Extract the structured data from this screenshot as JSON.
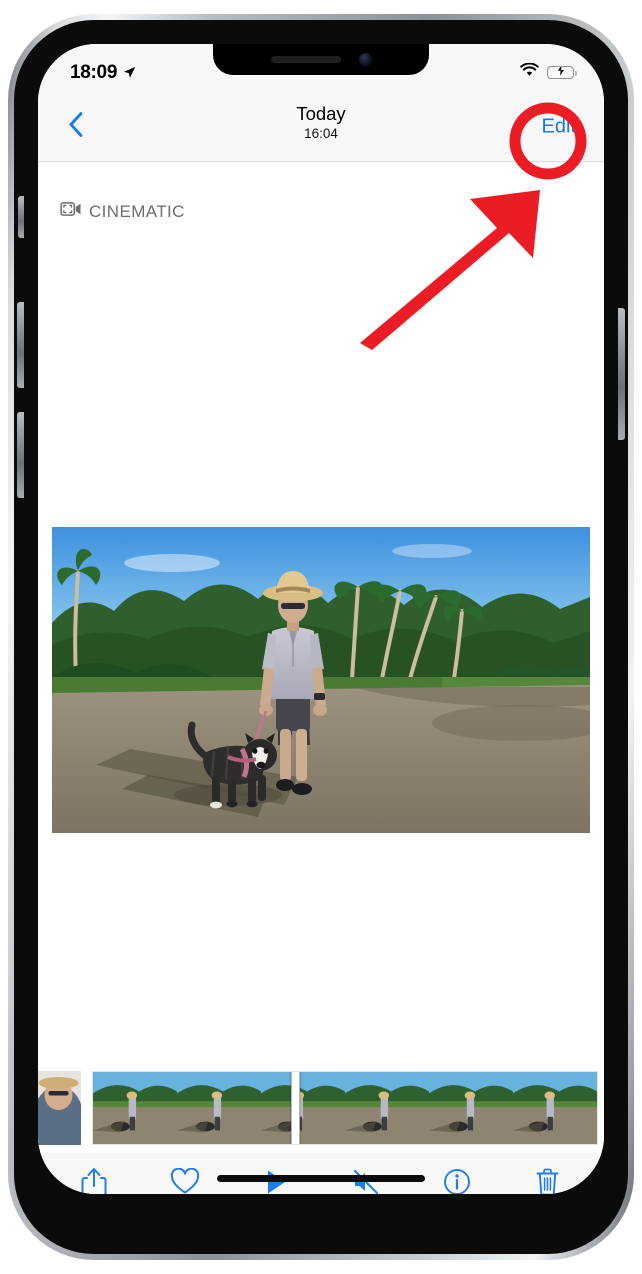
{
  "device": {
    "frame": "iphone",
    "notch_elements": [
      "earpiece-speaker",
      "front-camera"
    ],
    "hardware_buttons": [
      "ring-silent-switch",
      "volume-up-button",
      "volume-down-button",
      "side-power-button"
    ]
  },
  "status_bar": {
    "time": "18:09",
    "location_icon": "location-arrow-icon",
    "wifi_icon": "wifi-icon",
    "battery_icon": "battery-charging-icon",
    "battery_color": "#3ad14f",
    "battery_level_pct": 84
  },
  "nav_bar": {
    "back_icon": "chevron-left-icon",
    "title": "Today",
    "subtitle": "16:04",
    "edit_label": "Edit",
    "accent_color": "#1877f2"
  },
  "content": {
    "badge": {
      "icon": "cinematic-video-icon",
      "label": "CINEMATIC",
      "color": "#6e6e73"
    },
    "media": {
      "type": "video",
      "alt": "Man in straw sun hat holding a leashed black and white dog on a paved driveway with palm trees and blue sky"
    }
  },
  "filmstrip": {
    "previous_thumbnail_alt": "Partial thumbnail of previous photo",
    "frame_count": 6,
    "playhead_position_pct": 40,
    "playhead_name": "scrubber-playhead"
  },
  "toolbar": {
    "accent_color": "#1f7cf2",
    "items": [
      {
        "name": "share-button",
        "icon": "share-icon",
        "label": "Share"
      },
      {
        "name": "favorite-button",
        "icon": "heart-icon",
        "label": "Favorite"
      },
      {
        "name": "play-button",
        "icon": "play-icon",
        "label": "Play"
      },
      {
        "name": "mute-button",
        "icon": "speaker-mute-icon",
        "label": "Mute"
      },
      {
        "name": "info-button",
        "icon": "info-circle-icon",
        "label": "Info"
      },
      {
        "name": "delete-button",
        "icon": "trash-icon",
        "label": "Delete"
      }
    ]
  },
  "home_indicator": {
    "name": "home-indicator"
  },
  "annotation": {
    "highlight_color": "#ec1c24",
    "circle_target": "Edit",
    "arrow": "arrow pointing up-right toward the circled Edit button"
  }
}
